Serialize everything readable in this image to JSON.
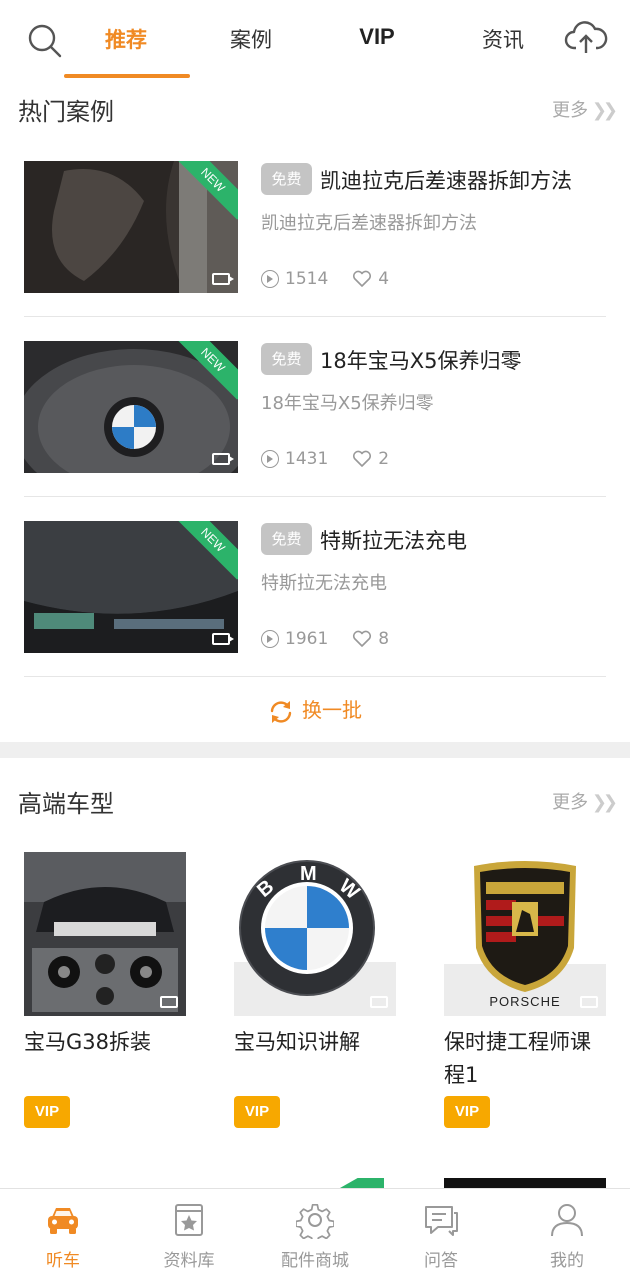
{
  "topbar": {
    "tabs": [
      "推荐",
      "案例",
      "VIP",
      "资讯"
    ],
    "active_tab": "推荐"
  },
  "hot_cases": {
    "title": "热门案例",
    "more": "更多",
    "items": [
      {
        "badge": "免费",
        "title": "凯迪拉克后差速器拆卸方法",
        "subtitle": "凯迪拉克后差速器拆卸方法",
        "views": "1514",
        "likes": "4",
        "ribbon": "NEW"
      },
      {
        "badge": "免费",
        "title": "18年宝马X5保养归零",
        "subtitle": "18年宝马X5保养归零",
        "views": "1431",
        "likes": "2",
        "ribbon": "NEW"
      },
      {
        "badge": "免费",
        "title": "特斯拉无法充电",
        "subtitle": "特斯拉无法充电",
        "views": "1961",
        "likes": "8",
        "ribbon": "NEW"
      }
    ],
    "refresh": "换一批"
  },
  "premium_models": {
    "title": "高端车型",
    "more": "更多",
    "items": [
      {
        "name": "宝马G38拆装",
        "tag": "VIP"
      },
      {
        "name": "宝马知识讲解",
        "tag": "VIP"
      },
      {
        "name": "保时捷工程师课程1",
        "tag": "VIP",
        "logo_text": "PORSCHE"
      }
    ]
  },
  "bottom_nav": {
    "items": [
      "听车",
      "资料库",
      "配件商城",
      "问答",
      "我的"
    ],
    "active": "听车"
  },
  "colors": {
    "accent": "#f08a24",
    "vip": "#f7a800",
    "ribbon": "#2cb36a"
  }
}
